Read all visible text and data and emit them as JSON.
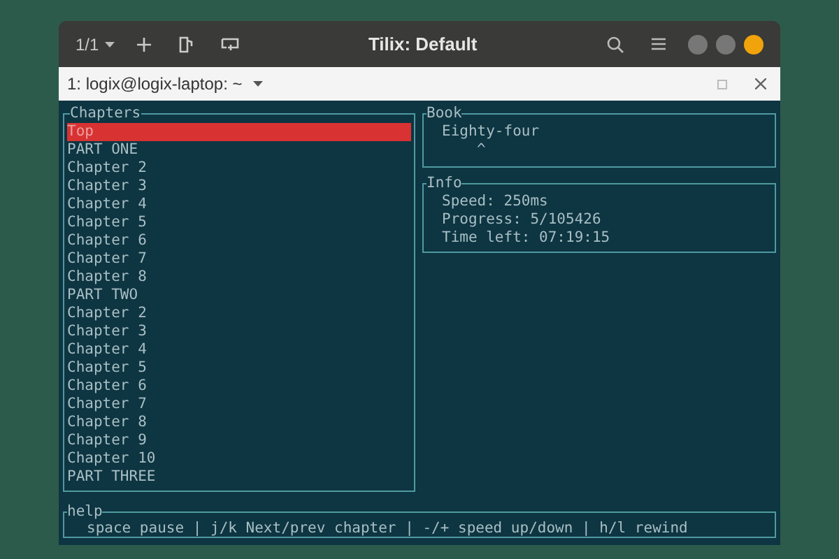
{
  "window": {
    "title": "Tilix: Default",
    "session": "1/1"
  },
  "terminal_tab": {
    "title": "1: logix@logix-laptop: ~"
  },
  "chapters": {
    "title": "Chapters",
    "items": [
      {
        "label": "Top",
        "selected": true
      },
      {
        "label": "PART ONE",
        "selected": false
      },
      {
        "label": "Chapter 2",
        "selected": false
      },
      {
        "label": "Chapter 3",
        "selected": false
      },
      {
        "label": "Chapter 4",
        "selected": false
      },
      {
        "label": "Chapter 5",
        "selected": false
      },
      {
        "label": "Chapter 6",
        "selected": false
      },
      {
        "label": "Chapter 7",
        "selected": false
      },
      {
        "label": "Chapter 8",
        "selected": false
      },
      {
        "label": "PART TWO",
        "selected": false
      },
      {
        "label": "Chapter 2",
        "selected": false
      },
      {
        "label": "Chapter 3",
        "selected": false
      },
      {
        "label": "Chapter 4",
        "selected": false
      },
      {
        "label": "Chapter 5",
        "selected": false
      },
      {
        "label": "Chapter 6",
        "selected": false
      },
      {
        "label": "Chapter 7",
        "selected": false
      },
      {
        "label": "Chapter 8",
        "selected": false
      },
      {
        "label": "Chapter 9",
        "selected": false
      },
      {
        "label": "Chapter 10",
        "selected": false
      },
      {
        "label": "PART THREE",
        "selected": false
      }
    ]
  },
  "book": {
    "title": "Book",
    "name": "Eighty-four",
    "marker": "^"
  },
  "info": {
    "title": "Info",
    "lines": [
      "Speed: 250ms",
      "Progress: 5/105426",
      "Time left: 07:19:15"
    ]
  },
  "help": {
    "title": "help",
    "text": "space pause | j/k Next/prev chapter | -/+ speed up/down | h/l rewind"
  }
}
